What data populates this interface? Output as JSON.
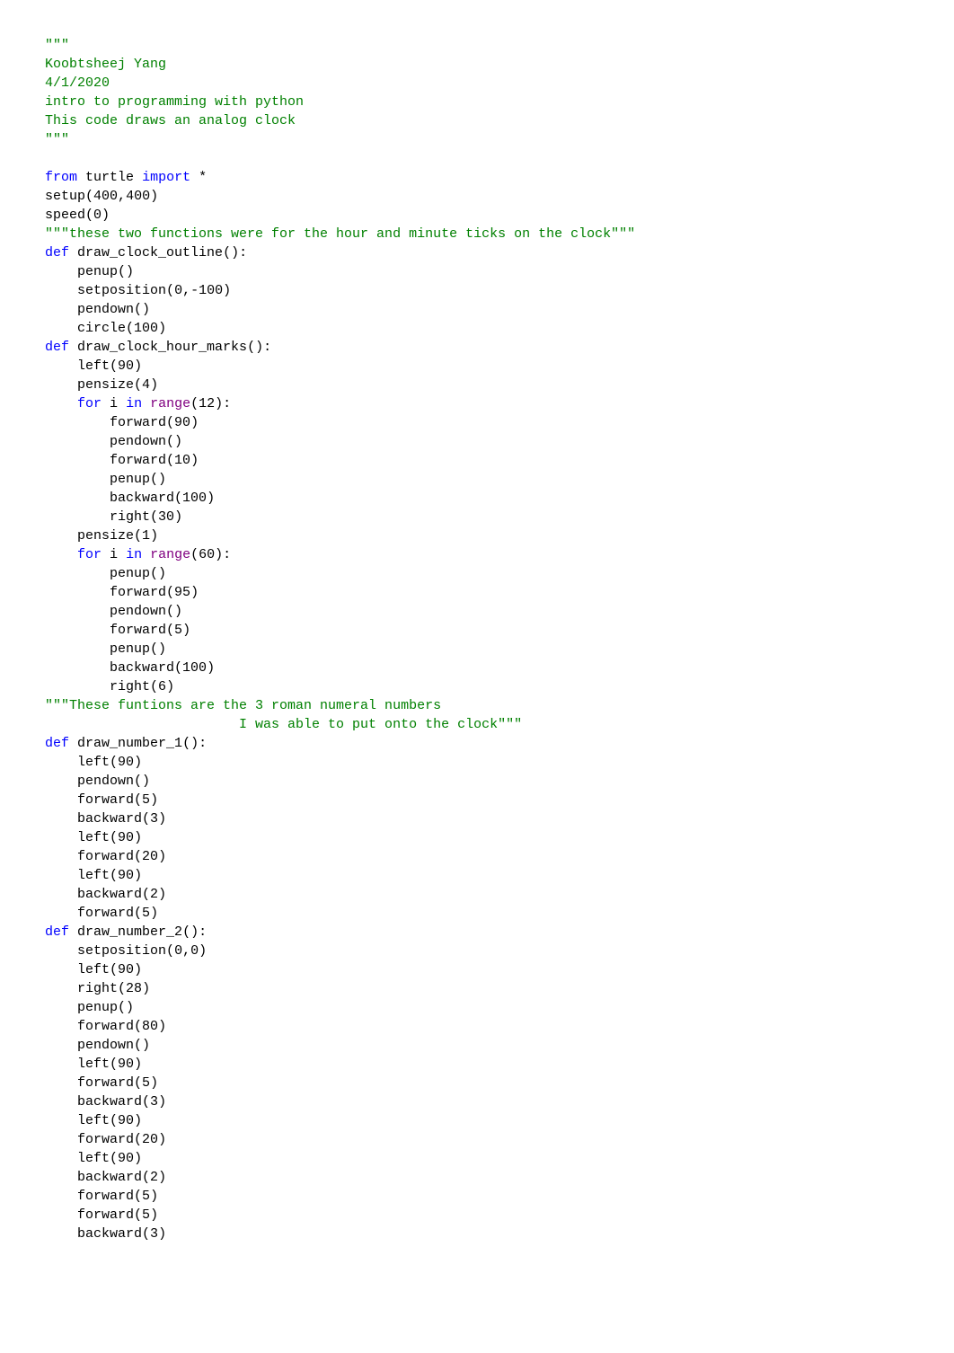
{
  "header_docstring": {
    "open": "\"\"\"",
    "author": "Koobtsheej Yang",
    "date": "4/1/2020",
    "course": "intro to programming with python",
    "desc": "This code draws an analog clock",
    "close": "\"\"\""
  },
  "import_line": {
    "kw1": "from",
    "mod": "turtle",
    "kw2": "import",
    "star": "*"
  },
  "setup_call": {
    "fn": "setup",
    "a1": "400",
    "a2": "400"
  },
  "speed_call": {
    "fn": "speed",
    "a1": "0"
  },
  "doc_two_fns": "\"\"\"these two functions were for the hour and minute ticks on the clock\"\"\"",
  "def_outline": {
    "kw": "def",
    "name": "draw_clock_outline",
    "suffix": "():"
  },
  "outline_body": {
    "l1": "penup()",
    "l2": {
      "fn": "setposition",
      "a1": "0",
      "a2": "-100"
    },
    "l3": "pendown()",
    "l4": {
      "fn": "circle",
      "a1": "100"
    }
  },
  "def_hourmarks": {
    "kw": "def",
    "name": "draw_clock_hour_marks",
    "suffix": "():"
  },
  "hm_body": {
    "l1": {
      "fn": "left",
      "a1": "90"
    },
    "l2": {
      "fn": "pensize",
      "a1": "4"
    },
    "for1": {
      "kw1": "for",
      "var": "i",
      "kw2": "in",
      "rng": "range",
      "arg": "12"
    },
    "f1b": {
      "l1": {
        "fn": "forward",
        "a1": "90"
      },
      "l2": "pendown()",
      "l3": {
        "fn": "forward",
        "a1": "10"
      },
      "l4": "penup()",
      "l5": {
        "fn": "backward",
        "a1": "100"
      },
      "l6": {
        "fn": "right",
        "a1": "30"
      }
    },
    "l3": {
      "fn": "pensize",
      "a1": "1"
    },
    "for2": {
      "kw1": "for",
      "var": "i",
      "kw2": "in",
      "rng": "range",
      "arg": "60"
    },
    "f2b": {
      "l1": "penup()",
      "l2": {
        "fn": "forward",
        "a1": "95"
      },
      "l3": "pendown()",
      "l4": {
        "fn": "forward",
        "a1": "5"
      },
      "l5": "penup()",
      "l6": {
        "fn": "backward",
        "a1": "100"
      },
      "l7": {
        "fn": "right",
        "a1": "6"
      }
    }
  },
  "doc_roman": {
    "l1": "\"\"\"These funtions are the 3 roman numeral numbers",
    "l2": "                        I was able to put onto the clock\"\"\""
  },
  "def_n1": {
    "kw": "def",
    "name": "draw_number_1",
    "suffix": "():"
  },
  "n1_body": {
    "l1": {
      "fn": "left",
      "a1": "90"
    },
    "l2": "pendown()",
    "l3": {
      "fn": "forward",
      "a1": "5"
    },
    "l4": {
      "fn": "backward",
      "a1": "3"
    },
    "l5": {
      "fn": "left",
      "a1": "90"
    },
    "l6": {
      "fn": "forward",
      "a1": "20"
    },
    "l7": {
      "fn": "left",
      "a1": "90"
    },
    "l8": {
      "fn": "backward",
      "a1": "2"
    },
    "l9": {
      "fn": "forward",
      "a1": "5"
    }
  },
  "def_n2": {
    "kw": "def",
    "name": "draw_number_2",
    "suffix": "():"
  },
  "n2_body": {
    "l1": {
      "fn": "setposition",
      "a1": "0",
      "a2": "0"
    },
    "l2": {
      "fn": "left",
      "a1": "90"
    },
    "l3": {
      "fn": "right",
      "a1": "28"
    },
    "l4": "penup()",
    "l5": {
      "fn": "forward",
      "a1": "80"
    },
    "l6": "pendown()",
    "l7": {
      "fn": "left",
      "a1": "90"
    },
    "l8": {
      "fn": "forward",
      "a1": "5"
    },
    "l9": {
      "fn": "backward",
      "a1": "3"
    },
    "l10": {
      "fn": "left",
      "a1": "90"
    },
    "l11": {
      "fn": "forward",
      "a1": "20"
    },
    "l12": {
      "fn": "left",
      "a1": "90"
    },
    "l13": {
      "fn": "backward",
      "a1": "2"
    },
    "l14": {
      "fn": "forward",
      "a1": "5"
    },
    "l15": {
      "fn": "forward",
      "a1": "5"
    },
    "l16": {
      "fn": "backward",
      "a1": "3"
    }
  }
}
